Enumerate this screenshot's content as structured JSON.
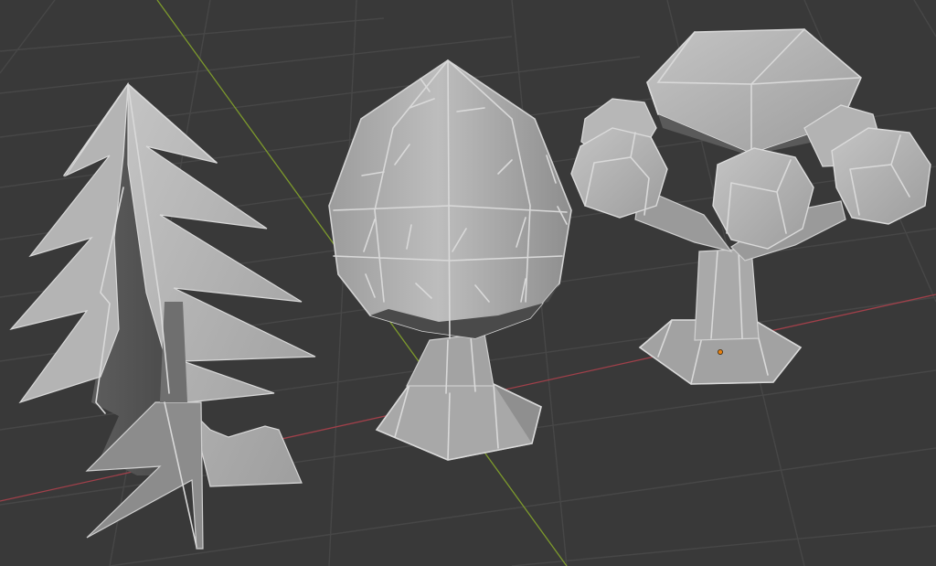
{
  "viewport": {
    "background_color": "#393939",
    "grid_color": "#474747",
    "x_axis_color": "#a0404a",
    "y_axis_color": "#7d9a2c",
    "origin_marker_color": "#e8800f"
  },
  "scene": {
    "objects": [
      "pine-tree",
      "round-tree",
      "bush-tree"
    ],
    "shading": "solid",
    "material_color": "#a9a9a9"
  }
}
